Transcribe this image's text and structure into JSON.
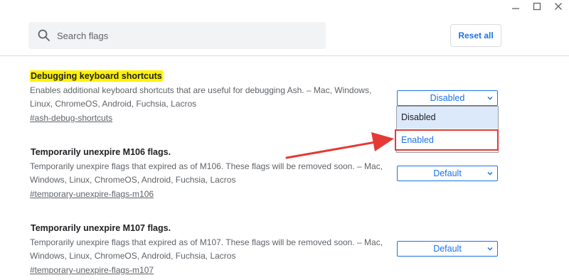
{
  "search": {
    "placeholder": "Search flags",
    "icon": "search-icon"
  },
  "header": {
    "reset_label": "Reset all"
  },
  "window_controls": [
    "minimize-icon",
    "maximize-icon",
    "close-icon"
  ],
  "flags": [
    {
      "title": "Debugging keyboard shortcuts",
      "description": "Enables additional keyboard shortcuts that are useful for debugging Ash. – Mac, Windows, Linux, ChromeOS, Android, Fuchsia, Lacros",
      "link": "#ash-debug-shortcuts",
      "selected": "Disabled",
      "options": [
        "Disabled",
        "Enabled"
      ]
    },
    {
      "title": "Temporarily unexpire M106 flags.",
      "description": "Temporarily unexpire flags that expired as of M106. These flags will be removed soon. – Mac, Windows, Linux, ChromeOS, Android, Fuchsia, Lacros",
      "link": "#temporary-unexpire-flags-m106",
      "selected": "Default"
    },
    {
      "title": "Temporarily unexpire M107 flags.",
      "description": "Temporarily unexpire flags that expired as of M107. These flags will be removed soon. – Mac, Windows, Linux, ChromeOS, Android, Fuchsia, Lacros",
      "link": "#temporary-unexpire-flags-m107",
      "selected": "Default"
    }
  ],
  "colors": {
    "accent": "#1a73e8",
    "highlight": "#fff200",
    "annotation": "#e53935"
  }
}
